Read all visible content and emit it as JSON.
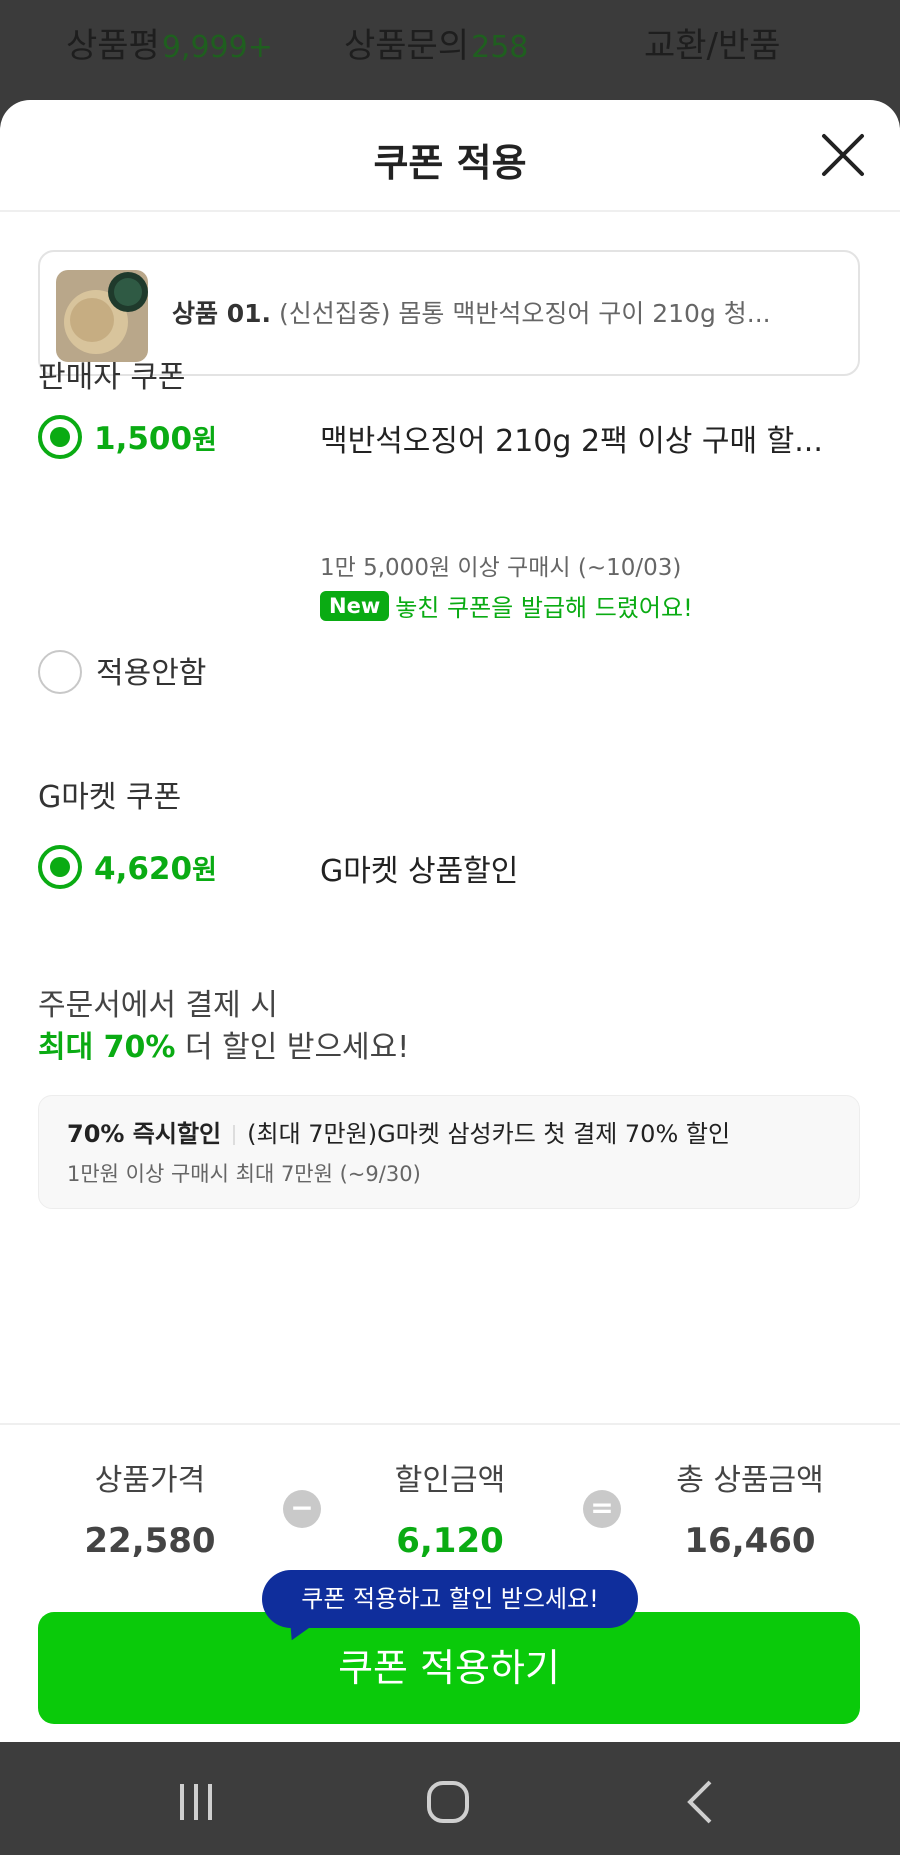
{
  "top_tabs": [
    {
      "label": "상품평",
      "count": "9,999+"
    },
    {
      "label": "상품문의",
      "count": "258"
    },
    {
      "label": "교환/반품",
      "count": ""
    }
  ],
  "sheet": {
    "title": "쿠폰 적용",
    "close_icon": "close-icon"
  },
  "product": {
    "index_label": "상품 01.",
    "name": "(신선집중) 몸통 맥반석오징어 구이 210g 청..."
  },
  "seller_coupon": {
    "section_title": "판매자 쿠폰",
    "amount": "1,500",
    "unit": "원",
    "name": "맥반석오징어 210g 2팩 이상 구매 할...",
    "condition": "1만 5,000원 이상 구매시 (~10/03)",
    "new_badge": "New",
    "new_message": "놓친 쿠폰을 발급해 드렸어요!",
    "none_label": "적용안함"
  },
  "gmarket_coupon": {
    "section_title": "G마켓 쿠폰",
    "amount": "4,620",
    "unit": "원",
    "name": "G마켓 상품할인"
  },
  "promo": {
    "line1": "주문서에서 결제 시",
    "highlight": "최대 70%",
    "line2_rest": " 더 할인 받으세요!",
    "card_tag": "70% 즉시할인",
    "card_title": "(최대 7만원)G마켓 삼성카드 첫 결제 70% 할인",
    "card_condition": "1만원 이상 구매시 최대 7만원 (~9/30)"
  },
  "summary": {
    "price_label": "상품가격",
    "price_value": "22,580",
    "minus": "−",
    "discount_label": "할인금액",
    "discount_value": "6,120",
    "equals": "=",
    "total_label": "총 상품금액",
    "total_value": "16,460"
  },
  "tooltip": "쿠폰 적용하고 할인 받으세요!",
  "apply_button": "쿠폰 적용하기",
  "colors": {
    "accent": "#0aab13",
    "button": "#0aca0a",
    "tooltip": "#0f2e9c"
  },
  "nav": [
    "recent-apps-icon",
    "home-icon",
    "back-icon"
  ]
}
